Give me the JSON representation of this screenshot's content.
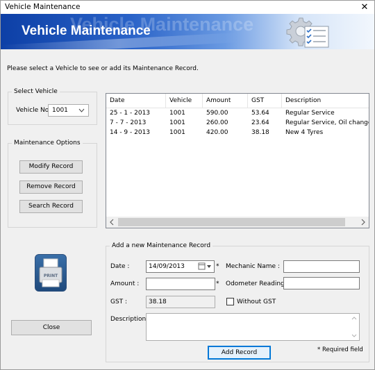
{
  "window": {
    "title": "Vehicle Maintenance",
    "close_glyph": "✕"
  },
  "banner": {
    "title": "Vehicle Maintenance",
    "ghost_text": "Vehicle Maintenance",
    "icon": "gear-checklist-icon"
  },
  "instruction": "Please select a Vehicle to see or add its Maintenance Record.",
  "select_vehicle": {
    "legend": "Select Vehicle",
    "vehicle_label": "Vehicle No",
    "vehicle_value": "1001"
  },
  "maintenance_options": {
    "legend": "Maintenance Options",
    "modify": "Modify Record",
    "remove": "Remove Record",
    "search": "Search Record"
  },
  "records": {
    "columns": [
      "Date",
      "Vehicle",
      "Amount",
      "GST",
      "Description"
    ],
    "rows": [
      [
        "25 - 1 - 2013",
        "1001",
        "590.00",
        "53.64",
        "Regular Service"
      ],
      [
        "7 - 7 - 2013",
        "1001",
        "260.00",
        "23.64",
        "Regular Service, Oil change"
      ],
      [
        "14 - 9 - 2013",
        "1001",
        "420.00",
        "38.18",
        "New 4 Tyres"
      ]
    ]
  },
  "new_record": {
    "legend": "Add a new Maintenance Record",
    "date_label": "Date :",
    "date_value": "14/09/2013",
    "amount_label": "Amount :",
    "amount_value": "",
    "gst_label": "GST :",
    "gst_value": "38.18",
    "mechanic_label": "Mechanic Name :",
    "mechanic_value": "",
    "odometer_label": "Odometer Reading :",
    "odometer_value": "",
    "without_gst_label": "Without GST",
    "description_label": "Description:",
    "required_marker": "*",
    "add_button": "Add Record",
    "required_note": "* Required field"
  },
  "printer": {
    "label": "PRINT",
    "icon": "printer-icon"
  },
  "close_button": "Close"
}
